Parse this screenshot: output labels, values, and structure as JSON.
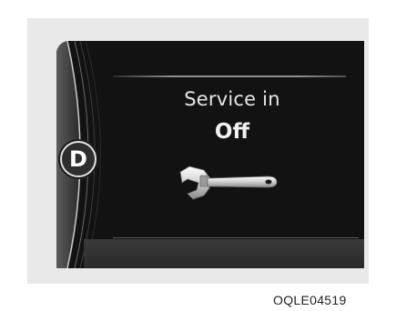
{
  "cluster": {
    "gear_indicator": "D",
    "service_title": "Service in",
    "service_value": "Off",
    "icon": "wrench-icon"
  },
  "caption": {
    "code": "OQLE04519"
  }
}
